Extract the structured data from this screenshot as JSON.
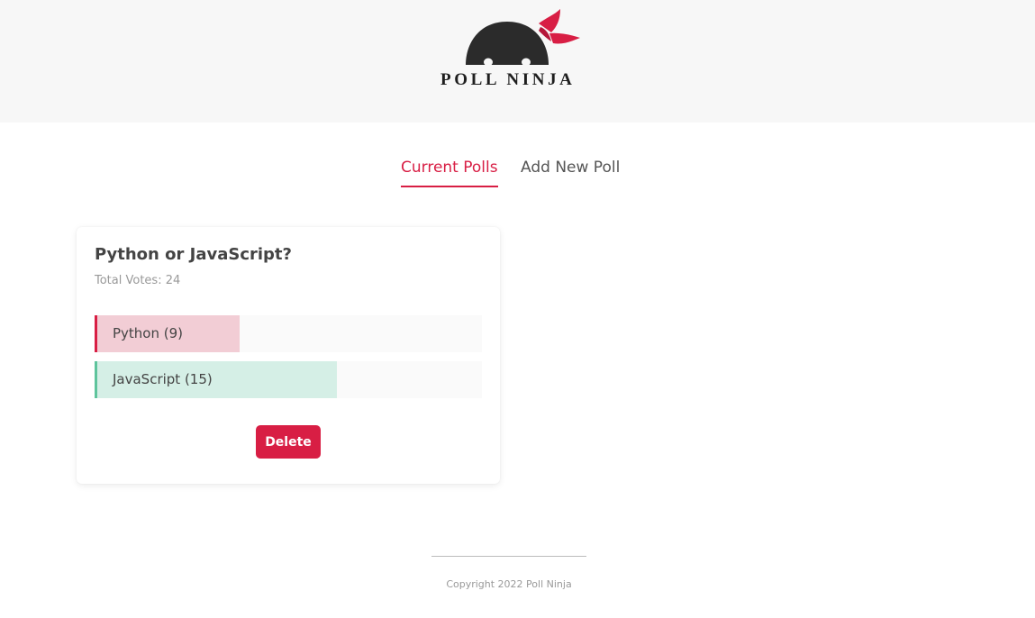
{
  "app": {
    "logo_text": "POLL NINJA"
  },
  "tabs": [
    {
      "label": "Current Polls",
      "active": true
    },
    {
      "label": "Add New Poll",
      "active": false
    }
  ],
  "polls": [
    {
      "question": "Python or JavaScript?",
      "total_votes_label": "Total Votes: 24",
      "total_votes": 24,
      "options": [
        {
          "label": "Python (9)",
          "votes": 9,
          "fill_fraction": 0.375,
          "color": "#f2cdd5",
          "accent": "#d81e44"
        },
        {
          "label": "JavaScript (15)",
          "votes": 15,
          "fill_fraction": 0.625,
          "color": "#d5efe6",
          "accent": "#5ec49c"
        }
      ],
      "delete_label": "Delete"
    }
  ],
  "footer": {
    "copyright": "Copyright 2022 Poll Ninja"
  },
  "colors": {
    "brand": "#d81e44",
    "header_bg": "#f7f7f7",
    "logo_dark": "#2b2b2b"
  }
}
